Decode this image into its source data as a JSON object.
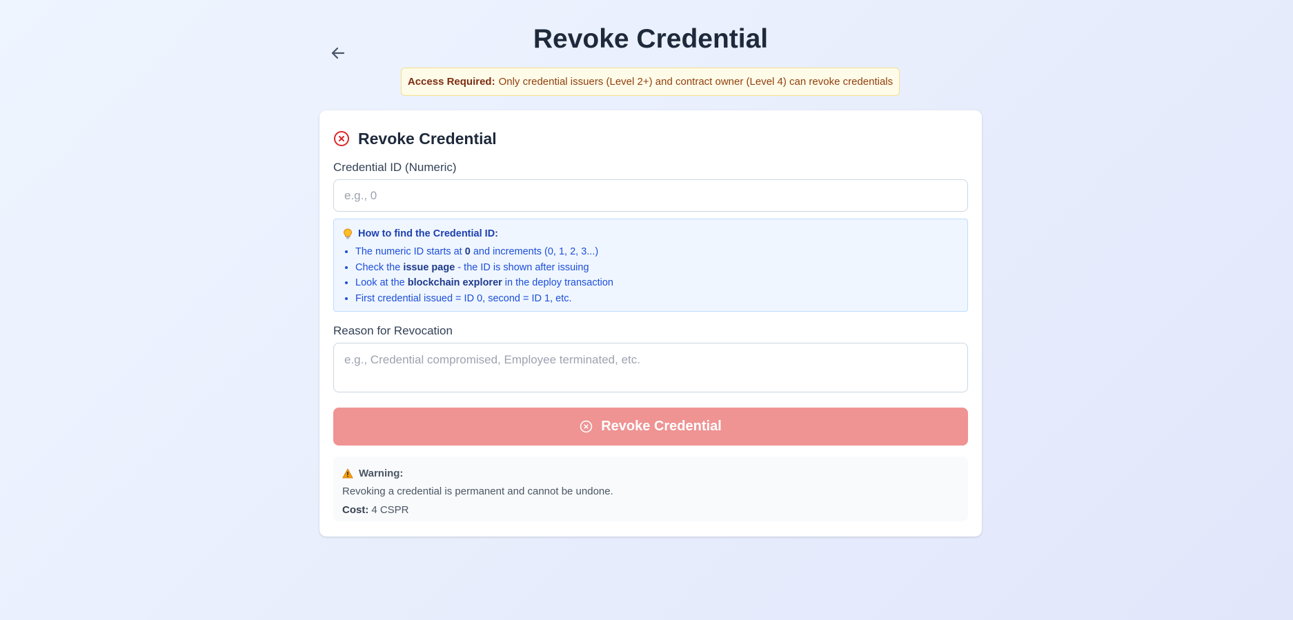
{
  "page": {
    "title": "Revoke Credential"
  },
  "access_banner": {
    "label": "Access Required:",
    "text": "Only credential issuers (Level 2+) and contract owner (Level 4) can revoke credentials"
  },
  "card": {
    "title": "Revoke Credential",
    "credential_id": {
      "label": "Credential ID (Numeric)",
      "value": "",
      "placeholder": "e.g., 0"
    },
    "tip": {
      "title": "How to find the Credential ID:",
      "items": [
        {
          "before": "The numeric ID starts at ",
          "bold": "0",
          "after": " and increments (0, 1, 2, 3...)"
        },
        {
          "before": "Check the ",
          "bold": "issue page",
          "after": " - the ID is shown after issuing"
        },
        {
          "before": "Look at the ",
          "bold": "blockchain explorer",
          "after": " in the deploy transaction"
        },
        {
          "before": "First credential issued = ID 0, second = ID 1, etc.",
          "bold": "",
          "after": ""
        }
      ]
    },
    "reason": {
      "label": "Reason for Revocation",
      "value": "",
      "placeholder": "e.g., Credential compromised, Employee terminated, etc."
    },
    "submit_label": "Revoke Credential",
    "warning": {
      "title": "Warning:",
      "text": "Revoking a credential is permanent and cannot be undone.",
      "cost_label": "Cost:",
      "cost_value": "4 CSPR"
    }
  },
  "icons": {
    "back": "arrow-left-icon",
    "card_header": "x-circle-icon",
    "tip": "lightbulb-icon",
    "submit": "x-circle-icon",
    "warning": "warning-triangle-icon"
  },
  "colors": {
    "danger": "#dc2626",
    "danger_disabled": "#ef9393",
    "info_text": "#1d4ed8",
    "banner_bg": "#fefbe8"
  }
}
